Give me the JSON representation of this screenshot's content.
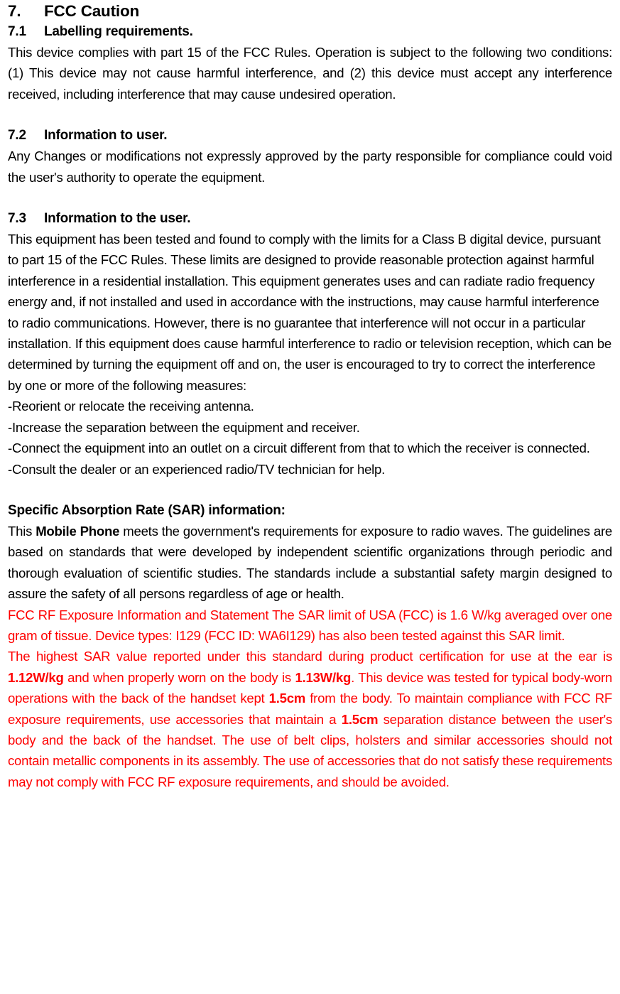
{
  "document": {
    "section_number": "7.",
    "section_title": "FCC Caution",
    "subsections": [
      {
        "number": "7.1",
        "title": "Labelling requirements.",
        "body": "This device complies with part 15 of the FCC Rules. Operation is subject to the following two conditions: (1) This device may not cause harmful interference, and (2) this device must accept any interference received, including interference that may cause undesired operation."
      },
      {
        "number": "7.2",
        "title": "Information to user.",
        "body": "Any Changes or modifications not expressly approved by the party responsible for compliance could void the user's authority to operate the equipment."
      },
      {
        "number": "7.3",
        "title": "Information to the user.",
        "body": "This equipment has been tested and found to comply with the limits for a Class B digital device, pursuant to part 15 of the FCC Rules. These limits are designed to provide reasonable protection against harmful interference in a residential installation. This equipment generates uses and can radiate radio frequency energy and, if not installed and used in accordance with the instructions, may cause harmful interference to radio communications. However, there is no guarantee that interference will not occur in a particular installation. If this equipment does cause harmful interference to radio or television reception, which can be determined by turning the equipment off and on, the user is encouraged to try to correct the interference by one or more of the following measures:",
        "measures": [
          "-Reorient or relocate the receiving antenna.",
          "-Increase the separation between the equipment and receiver.",
          "-Connect the equipment into an outlet on a circuit different from that to which the receiver is connected.",
          "-Consult the dealer or an experienced radio/TV technician for help."
        ]
      }
    ],
    "sar": {
      "heading": "Specific Absorption Rate (SAR) information:",
      "intro_part1": "This ",
      "intro_device": "Mobile Phone",
      "intro_part2": " meets the government's requirements for exposure to radio waves. The guidelines are based on standards that were developed by independent scientific organizations through periodic and thorough evaluation of scientific studies. The standards include a substantial safety margin designed to assure the safety of all persons regardless of age or health.",
      "exposure_statement": "FCC RF Exposure Information and Statement The SAR limit of USA (FCC) is 1.6 W/kg averaged over one gram of tissue. Device types: I129 (FCC ID: WA6I129) has also been tested against this SAR limit.",
      "sar_limit_value": "1.6 W/kg",
      "device_type": "I129",
      "fcc_id": "WA6I129",
      "highest_p1": "The highest SAR value reported under this standard during product certification for use at the ear is ",
      "sar_ear_value": "1.12W/kg",
      "highest_p2": " and when properly worn on the body is ",
      "sar_body_value": "1.13W/kg",
      "highest_p3": ". This device was tested for typical body-worn operations with the back of the handset kept ",
      "separation_value_1": "1.5cm",
      "highest_p4": " from the body. To maintain compliance with FCC RF exposure requirements, use accessories that maintain a ",
      "separation_value_2": "1.5cm",
      "highest_p5": " separation distance between the user's body and the back of the handset. The use of belt clips, holsters and similar accessories should not contain metallic components in its assembly. The use of accessories that do not satisfy these requirements may not comply with FCC RF exposure requirements, and should be avoided."
    },
    "colors": {
      "text": "#000000",
      "highlight": "#ff0000"
    }
  }
}
